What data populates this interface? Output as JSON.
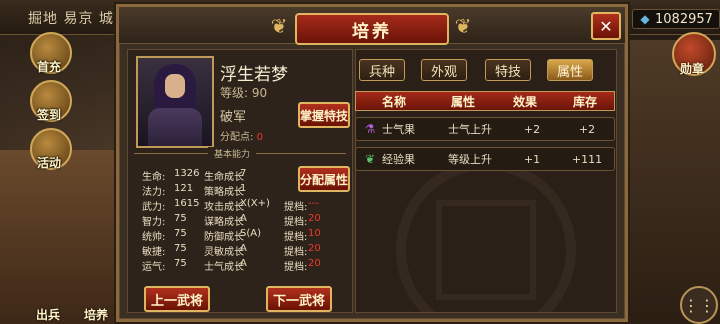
{
  "top_bar": {
    "left_text": "掘地 易京 城",
    "resource_value": "1082957"
  },
  "left_buttons": [
    "首充",
    "签到",
    "活动"
  ],
  "right_button": "勋章",
  "bottom_buttons": [
    "出兵",
    "培养"
  ],
  "dialog": {
    "title": "培养",
    "close_label": "✕"
  },
  "hero": {
    "name": "浮生若梦",
    "level_label": "等级:",
    "level_value": "90",
    "class": "破军",
    "points_label": "分配点:",
    "points_value": "0",
    "master_skill_button": "掌握特技",
    "section_label": "基本能力",
    "assign_button": "分配属性",
    "prev_button": "上一武将",
    "next_button": "下一武将"
  },
  "stats": [
    {
      "label": "生命:",
      "value": "1326",
      "growth_label": "生命成长",
      "growth_value": "7",
      "rank_label": "",
      "rank_value": ""
    },
    {
      "label": "法力:",
      "value": "121",
      "growth_label": "策略成长",
      "growth_value": "1",
      "rank_label": "",
      "rank_value": ""
    },
    {
      "label": "武力:",
      "value": "1615",
      "growth_label": "攻击成长",
      "growth_value": "X(X+)",
      "rank_label": "提档:",
      "rank_value": "---"
    },
    {
      "label": "智力:",
      "value": "75",
      "growth_label": "谋略成长",
      "growth_value": "A",
      "rank_label": "提档:",
      "rank_value": "20"
    },
    {
      "label": "统帅:",
      "value": "75",
      "growth_label": "防御成长",
      "growth_value": "S(A)",
      "rank_label": "提档:",
      "rank_value": "10"
    },
    {
      "label": "敏捷:",
      "value": "75",
      "growth_label": "灵敏成长",
      "growth_value": "A",
      "rank_label": "提档:",
      "rank_value": "20"
    },
    {
      "label": "运气:",
      "value": "75",
      "growth_label": "士气成长",
      "growth_value": "A",
      "rank_label": "提档:",
      "rank_value": "20"
    }
  ],
  "tabs": [
    {
      "label": "兵种",
      "active": false
    },
    {
      "label": "外观",
      "active": false
    },
    {
      "label": "特技",
      "active": false
    },
    {
      "label": "属性",
      "active": true
    }
  ],
  "table": {
    "headers": [
      "名称",
      "属性",
      "效果",
      "库存"
    ],
    "rows": [
      {
        "icon": "potion-icon",
        "name": "士气果",
        "attr": "士气上升",
        "effect": "+2",
        "stock": "+2"
      },
      {
        "icon": "gourd-icon",
        "name": "经验果",
        "attr": "等级上升",
        "effect": "+1",
        "stock": "+111"
      }
    ]
  },
  "colors": {
    "accent_red": "#a52a1a",
    "gold_border": "#e0b560",
    "rank_red": "#e53a2a"
  }
}
